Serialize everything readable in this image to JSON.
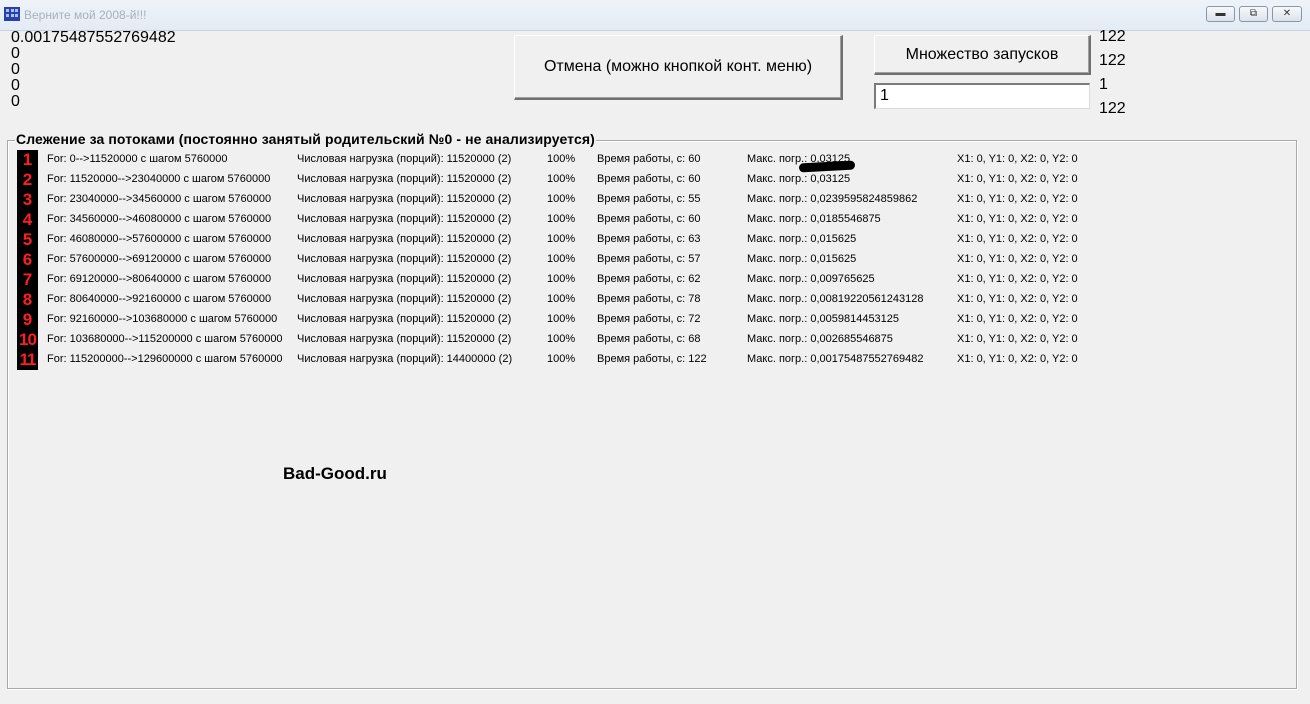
{
  "window": {
    "title": "Верните мой 2008-й!!!",
    "buttons": {
      "minimize": "",
      "maximize": "",
      "close": ""
    }
  },
  "left_values": [
    "0.00175487552769482",
    "0",
    "0",
    "0",
    "0"
  ],
  "buttons": {
    "cancel_label": "Отмена (можно кнопкой конт. меню)",
    "multi_label": "Множество запусков"
  },
  "input": {
    "value": "1"
  },
  "right_values": [
    "122",
    "122",
    "1",
    "122"
  ],
  "group": {
    "title": "Слежение за потоками (постоянно занятый родительский №0 - не анализируется)",
    "rows": [
      {
        "n": "1",
        "for": "For: 0-->11520000 с шагом 5760000",
        "load": "Числовая нагрузка (порций): 11520000 (2)",
        "pct": "100%",
        "time": "Время работы, с: 60",
        "err": "Макс. погр.: 0,03125",
        "xy": "X1: 0, Y1: 0, X2: 0, Y2: 0"
      },
      {
        "n": "2",
        "for": "For: 11520000-->23040000 с шагом 5760000",
        "load": "Числовая нагрузка (порций): 11520000 (2)",
        "pct": "100%",
        "time": "Время работы, с: 60",
        "err": "Макс. погр.: 0,03125",
        "xy": "X1: 0, Y1: 0, X2: 0, Y2: 0"
      },
      {
        "n": "3",
        "for": "For: 23040000-->34560000 с шагом 5760000",
        "load": "Числовая нагрузка (порций): 11520000 (2)",
        "pct": "100%",
        "time": "Время работы, с: 55",
        "err": "Макс. погр.: 0,0239595824859862",
        "xy": "X1: 0, Y1: 0, X2: 0, Y2: 0"
      },
      {
        "n": "4",
        "for": "For: 34560000-->46080000 с шагом 5760000",
        "load": "Числовая нагрузка (порций): 11520000 (2)",
        "pct": "100%",
        "time": "Время работы, с: 60",
        "err": "Макс. погр.: 0,0185546875",
        "xy": "X1: 0, Y1: 0, X2: 0, Y2: 0"
      },
      {
        "n": "5",
        "for": "For: 46080000-->57600000 с шагом 5760000",
        "load": "Числовая нагрузка (порций): 11520000 (2)",
        "pct": "100%",
        "time": "Время работы, с: 63",
        "err": "Макс. погр.: 0,015625",
        "xy": "X1: 0, Y1: 0, X2: 0, Y2: 0"
      },
      {
        "n": "6",
        "for": "For: 57600000-->69120000 с шагом 5760000",
        "load": "Числовая нагрузка (порций): 11520000 (2)",
        "pct": "100%",
        "time": "Время работы, с: 57",
        "err": "Макс. погр.: 0,015625",
        "xy": "X1: 0, Y1: 0, X2: 0, Y2: 0"
      },
      {
        "n": "7",
        "for": "For: 69120000-->80640000 с шагом 5760000",
        "load": "Числовая нагрузка (порций): 11520000 (2)",
        "pct": "100%",
        "time": "Время работы, с: 62",
        "err": "Макс. погр.: 0,009765625",
        "xy": "X1: 0, Y1: 0, X2: 0, Y2: 0"
      },
      {
        "n": "8",
        "for": "For: 80640000-->92160000 с шагом 5760000",
        "load": "Числовая нагрузка (порций): 11520000 (2)",
        "pct": "100%",
        "time": "Время работы, с: 78",
        "err": "Макс. погр.: 0,00819220561243128",
        "xy": "X1: 0, Y1: 0, X2: 0, Y2: 0"
      },
      {
        "n": "9",
        "for": "For: 92160000-->103680000 с шагом 5760000",
        "load": "Числовая нагрузка (порций): 11520000 (2)",
        "pct": "100%",
        "time": "Время работы, с: 72",
        "err": "Макс. погр.: 0,0059814453125",
        "xy": "X1: 0, Y1: 0, X2: 0, Y2: 0"
      },
      {
        "n": "10",
        "for": "For: 103680000-->115200000 с шагом 5760000",
        "load": "Числовая нагрузка (порций): 11520000 (2)",
        "pct": "100%",
        "time": "Время работы, с: 68",
        "err": "Макс. погр.: 0,002685546875",
        "xy": "X1: 0, Y1: 0, X2: 0, Y2: 0"
      },
      {
        "n": "11",
        "for": "For: 115200000-->129600000 с шагом 5760000",
        "load": "Числовая нагрузка (порций): 14400000 (2)",
        "pct": "100%",
        "time": "Время работы, с: 122",
        "err": "Макс. погр.: 0,00175487552769482",
        "xy": "X1: 0, Y1: 0, X2: 0, Y2: 0"
      }
    ]
  },
  "watermark": "Bad-Good.ru"
}
